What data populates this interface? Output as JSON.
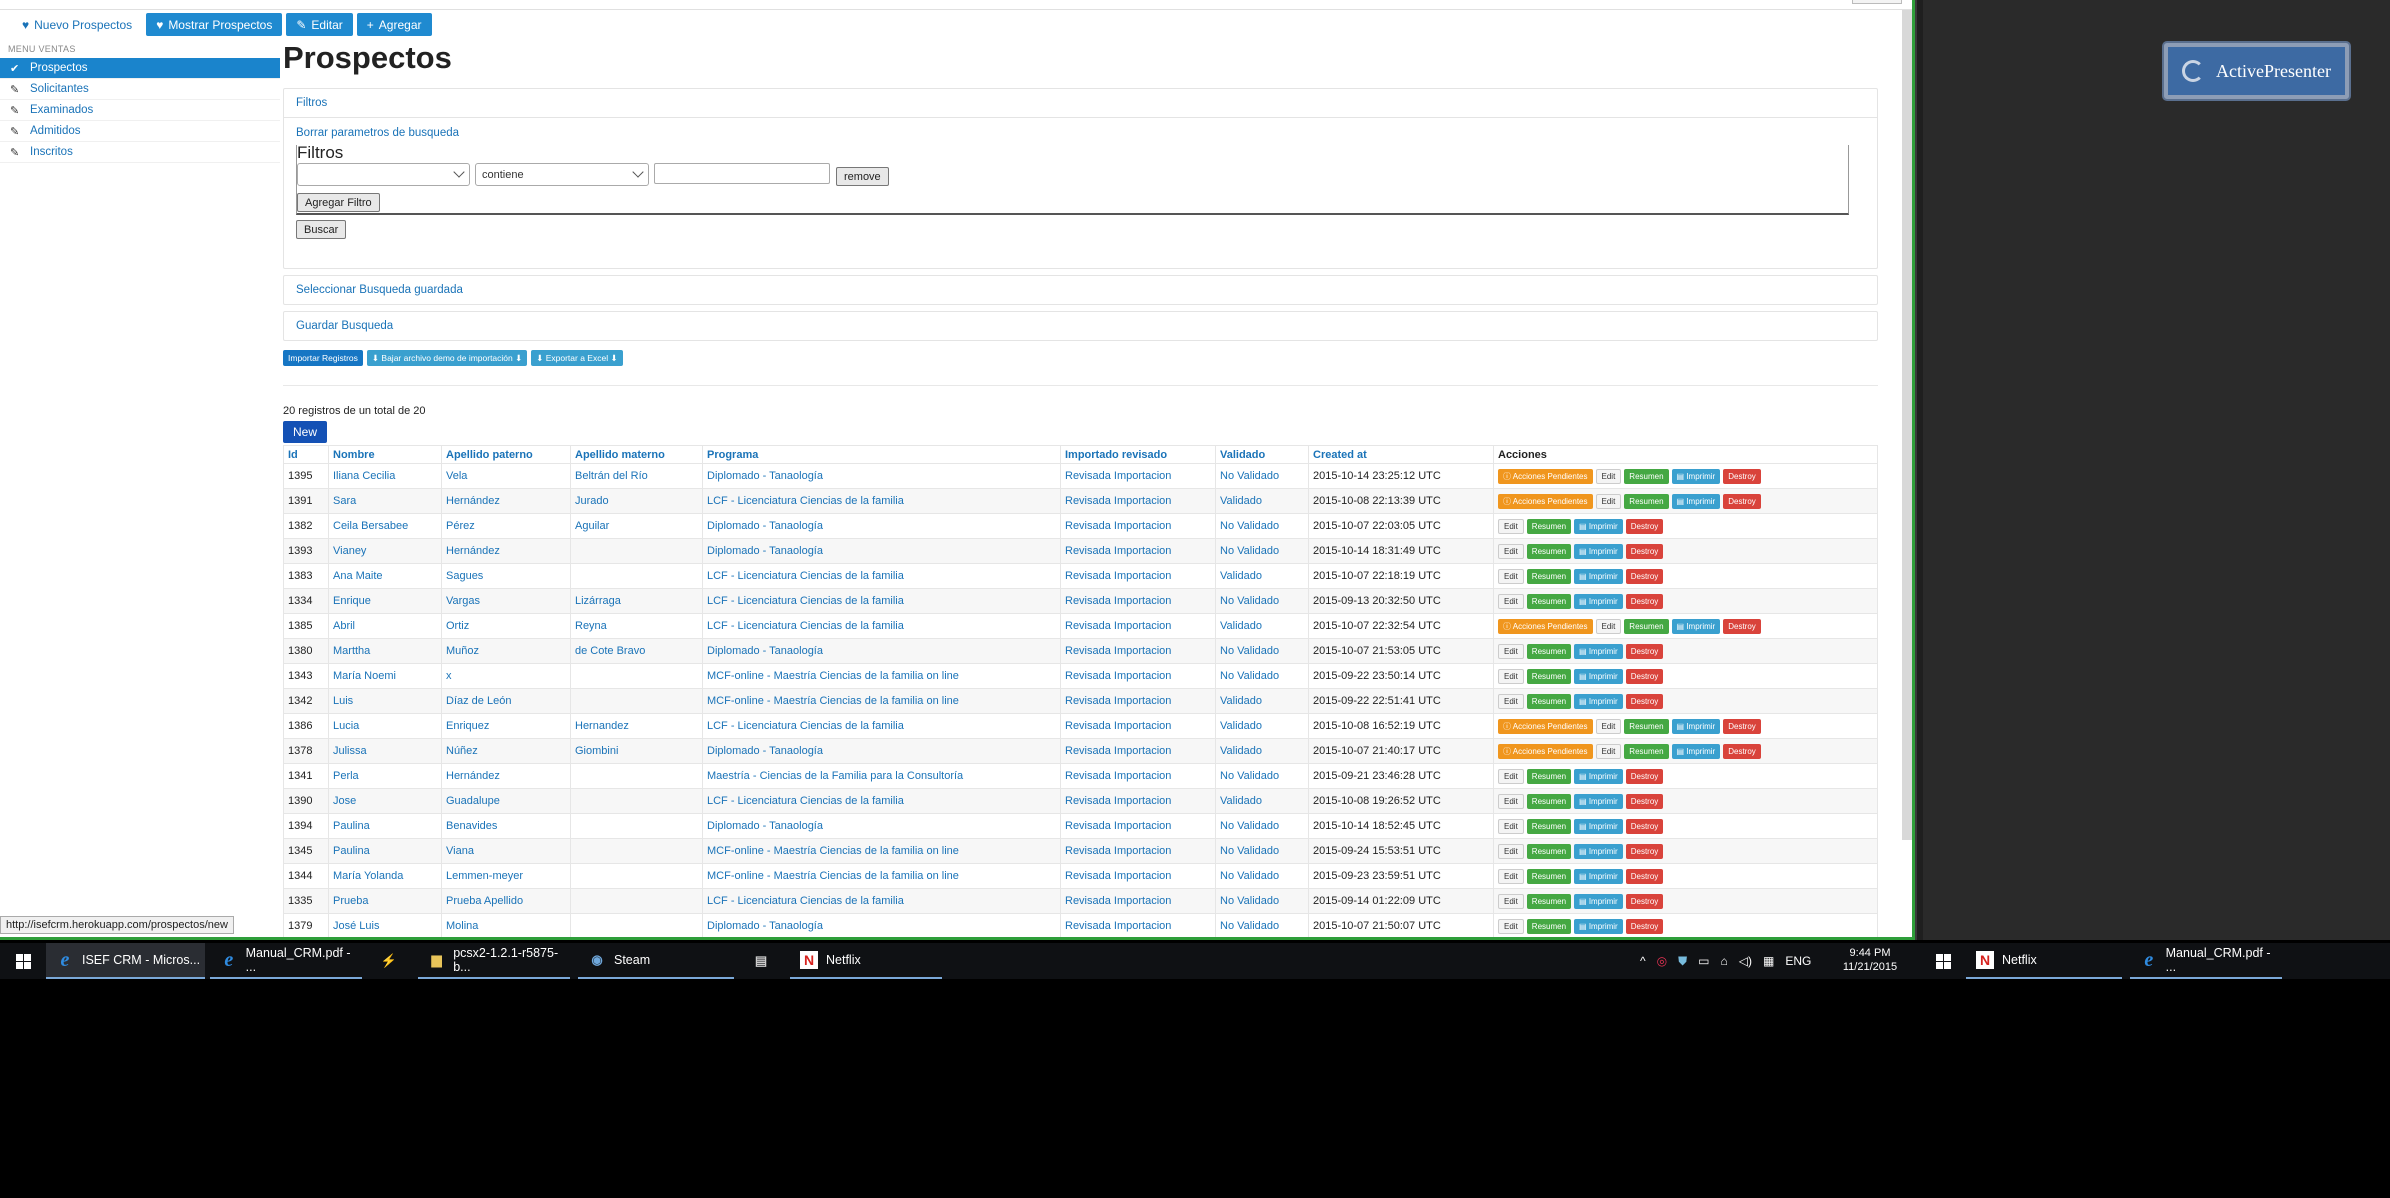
{
  "topnav": [
    {
      "label": "Nuevo Prospectos",
      "icon": "heart-icon",
      "style": "link"
    },
    {
      "label": "Mostrar Prospectos",
      "icon": "heart-icon",
      "style": "blue"
    },
    {
      "label": "Editar",
      "icon": "pencil-icon",
      "style": "blue"
    },
    {
      "label": "Agregar",
      "icon": "plus-icon",
      "style": "blue"
    }
  ],
  "sidebar": {
    "heading": "MENU VENTAS",
    "items": [
      {
        "label": "Prospectos",
        "icon": "check-icon",
        "active": true
      },
      {
        "label": "Solicitantes",
        "icon": "pencil-icon"
      },
      {
        "label": "Examinados",
        "icon": "pencil-icon"
      },
      {
        "label": "Admitidos",
        "icon": "pencil-icon"
      },
      {
        "label": "Inscritos",
        "icon": "pencil-icon"
      }
    ]
  },
  "main": {
    "title": "Prospectos",
    "filters_header": "Filtros",
    "clear_link": "Borrar parametros de busqueda",
    "fieldset_legend": "Filtros",
    "filter_field_value": "",
    "filter_op_value": "contiene",
    "filter_text_value": "",
    "remove_label": "remove",
    "add_filter_label": "Agregar Filtro",
    "search_label": "Buscar",
    "select_saved_label": "Seleccionar Busqueda guardada",
    "save_search_label": "Guardar Busqueda",
    "action_buttons": [
      "Importar Registros",
      "Bajar archivo demo de importación",
      "Exportar a Excel"
    ],
    "count_text": "20 registros de un total de 20",
    "new_label": "New"
  },
  "table": {
    "columns": [
      "Id",
      "Nombre",
      "Apellido paterno",
      "Apellido materno",
      "Programa",
      "Importado revisado",
      "Validado",
      "Created at",
      "Acciones"
    ],
    "action_labels": {
      "pending": "Acciones Pendientes",
      "edit": "Edit",
      "summary": "Resumen",
      "print": "Imprimir",
      "destroy": "Destroy"
    },
    "rows": [
      {
        "id": "1395",
        "nombre": "Iliana Cecilia",
        "paterno": "Vela",
        "materno": "Beltrán del Río",
        "programa": "Diplomado - Tanaología",
        "importado": "Revisada Importacion",
        "validado": "No Validado",
        "created": "2015-10-14 23:25:12 UTC",
        "pending": true
      },
      {
        "id": "1391",
        "nombre": "Sara",
        "paterno": "Hernández",
        "materno": "Jurado",
        "programa": "LCF - Licenciatura Ciencias de la familia",
        "importado": "Revisada Importacion",
        "validado": "Validado",
        "created": "2015-10-08 22:13:39 UTC",
        "pending": true
      },
      {
        "id": "1382",
        "nombre": "Ceila Bersabee",
        "paterno": "Pérez",
        "materno": "Aguilar",
        "programa": "Diplomado - Tanaología",
        "importado": "Revisada Importacion",
        "validado": "No Validado",
        "created": "2015-10-07 22:03:05 UTC",
        "pending": false
      },
      {
        "id": "1393",
        "nombre": "Vianey",
        "paterno": "Hernández",
        "materno": "",
        "programa": "Diplomado - Tanaología",
        "importado": "Revisada Importacion",
        "validado": "No Validado",
        "created": "2015-10-14 18:31:49 UTC",
        "pending": false
      },
      {
        "id": "1383",
        "nombre": "Ana Maite",
        "paterno": "Sagues",
        "materno": "",
        "programa": "LCF - Licenciatura Ciencias de la familia",
        "importado": "Revisada Importacion",
        "validado": "Validado",
        "created": "2015-10-07 22:18:19 UTC",
        "pending": false
      },
      {
        "id": "1334",
        "nombre": "Enrique",
        "paterno": "Vargas",
        "materno": "Lizárraga",
        "programa": "LCF - Licenciatura Ciencias de la familia",
        "importado": "Revisada Importacion",
        "validado": "No Validado",
        "created": "2015-09-13 20:32:50 UTC",
        "pending": false
      },
      {
        "id": "1385",
        "nombre": "Abril",
        "paterno": "Ortiz",
        "materno": "Reyna",
        "programa": "LCF - Licenciatura Ciencias de la familia",
        "importado": "Revisada Importacion",
        "validado": "Validado",
        "created": "2015-10-07 22:32:54 UTC",
        "pending": true
      },
      {
        "id": "1380",
        "nombre": "Marttha",
        "paterno": "Muñoz",
        "materno": "de Cote Bravo",
        "programa": "Diplomado - Tanaología",
        "importado": "Revisada Importacion",
        "validado": "No Validado",
        "created": "2015-10-07 21:53:05 UTC",
        "pending": false
      },
      {
        "id": "1343",
        "nombre": "María Noemi",
        "paterno": "x",
        "materno": "",
        "programa": "MCF-online - Maestría Ciencias de la familia on line",
        "importado": "Revisada Importacion",
        "validado": "No Validado",
        "created": "2015-09-22 23:50:14 UTC",
        "pending": false
      },
      {
        "id": "1342",
        "nombre": "Luis",
        "paterno": "Díaz de León",
        "materno": "",
        "programa": "MCF-online - Maestría Ciencias de la familia on line",
        "importado": "Revisada Importacion",
        "validado": "Validado",
        "created": "2015-09-22 22:51:41 UTC",
        "pending": false
      },
      {
        "id": "1386",
        "nombre": "Lucia",
        "paterno": "Enriquez",
        "materno": "Hernandez",
        "programa": "LCF - Licenciatura Ciencias de la familia",
        "importado": "Revisada Importacion",
        "validado": "Validado",
        "created": "2015-10-08 16:52:19 UTC",
        "pending": true
      },
      {
        "id": "1378",
        "nombre": "Julissa",
        "paterno": "Núñez",
        "materno": "Giombini",
        "programa": "Diplomado - Tanaología",
        "importado": "Revisada Importacion",
        "validado": "Validado",
        "created": "2015-10-07 21:40:17 UTC",
        "pending": true
      },
      {
        "id": "1341",
        "nombre": "Perla",
        "paterno": "Hernández",
        "materno": "",
        "programa": "Maestría - Ciencias de la Familia para la Consultoría",
        "importado": "Revisada Importacion",
        "validado": "No Validado",
        "created": "2015-09-21 23:46:28 UTC",
        "pending": false
      },
      {
        "id": "1390",
        "nombre": "Jose",
        "paterno": "Guadalupe",
        "materno": "",
        "programa": "LCF - Licenciatura Ciencias de la familia",
        "importado": "Revisada Importacion",
        "validado": "Validado",
        "created": "2015-10-08 19:26:52 UTC",
        "pending": false
      },
      {
        "id": "1394",
        "nombre": "Paulina",
        "paterno": "Benavides",
        "materno": "",
        "programa": "Diplomado - Tanaología",
        "importado": "Revisada Importacion",
        "validado": "No Validado",
        "created": "2015-10-14 18:52:45 UTC",
        "pending": false
      },
      {
        "id": "1345",
        "nombre": "Paulina",
        "paterno": "Viana",
        "materno": "",
        "programa": "MCF-online - Maestría Ciencias de la familia on line",
        "importado": "Revisada Importacion",
        "validado": "No Validado",
        "created": "2015-09-24 15:53:51 UTC",
        "pending": false
      },
      {
        "id": "1344",
        "nombre": "María Yolanda",
        "paterno": "Lemmen-meyer",
        "materno": "",
        "programa": "MCF-online - Maestría Ciencias de la familia on line",
        "importado": "Revisada Importacion",
        "validado": "No Validado",
        "created": "2015-09-23 23:59:51 UTC",
        "pending": false
      },
      {
        "id": "1335",
        "nombre": "Prueba",
        "paterno": "Prueba Apellido",
        "materno": "",
        "programa": "LCF - Licenciatura Ciencias de la familia",
        "importado": "Revisada Importacion",
        "validado": "No Validado",
        "created": "2015-09-14 01:22:09 UTC",
        "pending": false
      },
      {
        "id": "1379",
        "nombre": "José Luis",
        "paterno": "Molina",
        "materno": "",
        "programa": "Diplomado - Tanaología",
        "importado": "Revisada Importacion",
        "validado": "No Validado",
        "created": "2015-10-07 21:50:07 UTC",
        "pending": false
      }
    ]
  },
  "status_url": "http://isefcrm.herokuapp.com/prospectos/new",
  "overlay_badge": "ActivePresenter",
  "taskbar": {
    "items": [
      {
        "label": "ISEF CRM - Micros...",
        "icon": "ie-icon"
      },
      {
        "label": "Manual_CRM.pdf - ...",
        "icon": "ie-icon"
      },
      {
        "label": "",
        "icon": "tools-icon"
      },
      {
        "label": "pcsx2-1.2.1-r5875-b...",
        "icon": "folder-icon"
      },
      {
        "label": "Steam",
        "icon": "steam-icon"
      },
      {
        "label": "",
        "icon": "printer-icon"
      },
      {
        "label": "Netflix",
        "icon": "netflix-icon"
      }
    ],
    "lang": "ENG",
    "time": "9:44 PM",
    "date": "11/21/2015",
    "second_monitor": [
      {
        "label": "Netflix",
        "icon": "netflix-icon"
      },
      {
        "label": "Manual_CRM.pdf - ...",
        "icon": "ie-icon"
      }
    ]
  }
}
